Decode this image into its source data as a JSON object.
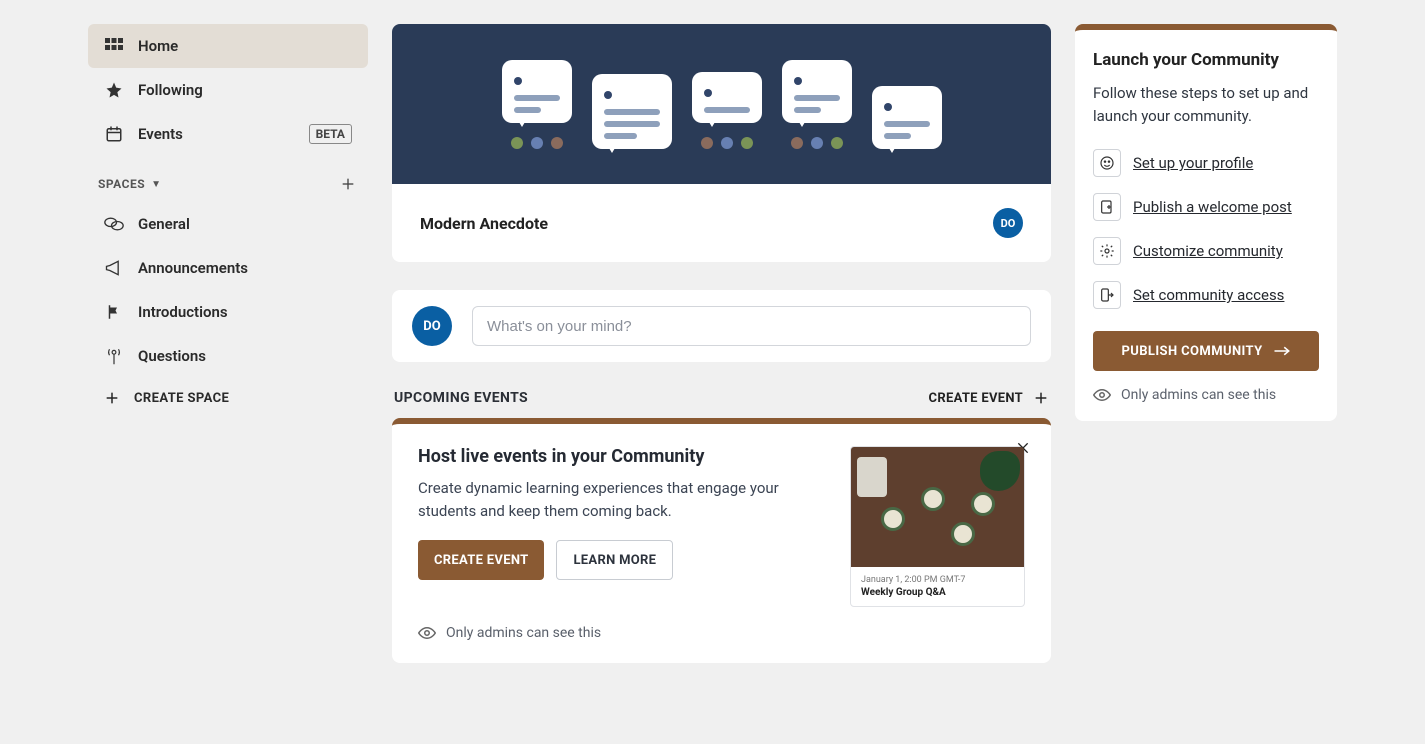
{
  "sidebar": {
    "items": [
      {
        "label": "Home",
        "icon": "grid-icon",
        "active": true
      },
      {
        "label": "Following",
        "icon": "star-icon"
      },
      {
        "label": "Events",
        "icon": "calendar-icon",
        "badge": "BETA"
      }
    ],
    "spaces_label": "SPACES",
    "spaces": [
      {
        "label": "General",
        "icon": "chat-bubbles-icon"
      },
      {
        "label": "Announcements",
        "icon": "megaphone-icon"
      },
      {
        "label": "Introductions",
        "icon": "flag-icon"
      },
      {
        "label": "Questions",
        "icon": "antenna-icon"
      }
    ],
    "create_space_label": "CREATE SPACE"
  },
  "hero": {
    "title": "Modern Anecdote",
    "avatar_initials": "DO"
  },
  "composer": {
    "avatar_initials": "DO",
    "placeholder": "What's on your mind?"
  },
  "events": {
    "section_title": "UPCOMING EVENTS",
    "create_label": "CREATE EVENT"
  },
  "promo": {
    "title": "Host live events in your Community",
    "desc": "Create dynamic learning experiences that engage your students and keep them coming back.",
    "primary_btn": "CREATE EVENT",
    "secondary_btn": "LEARN MORE",
    "sample_date": "January 1, 2:00 PM GMT-7",
    "sample_title": "Weekly Group Q&A",
    "admin_note": "Only admins can see this"
  },
  "launch": {
    "title": "Launch your Community",
    "desc": "Follow these steps to set up and launch your community.",
    "steps": [
      {
        "label": "Set up your profile",
        "icon": "smiley-icon"
      },
      {
        "label": "Publish a welcome post",
        "icon": "post-add-icon"
      },
      {
        "label": "Customize community",
        "icon": "gear-icon"
      },
      {
        "label": "Set community access",
        "icon": "exit-icon"
      }
    ],
    "publish_btn": "PUBLISH COMMUNITY",
    "admin_note": "Only admins can see this"
  }
}
